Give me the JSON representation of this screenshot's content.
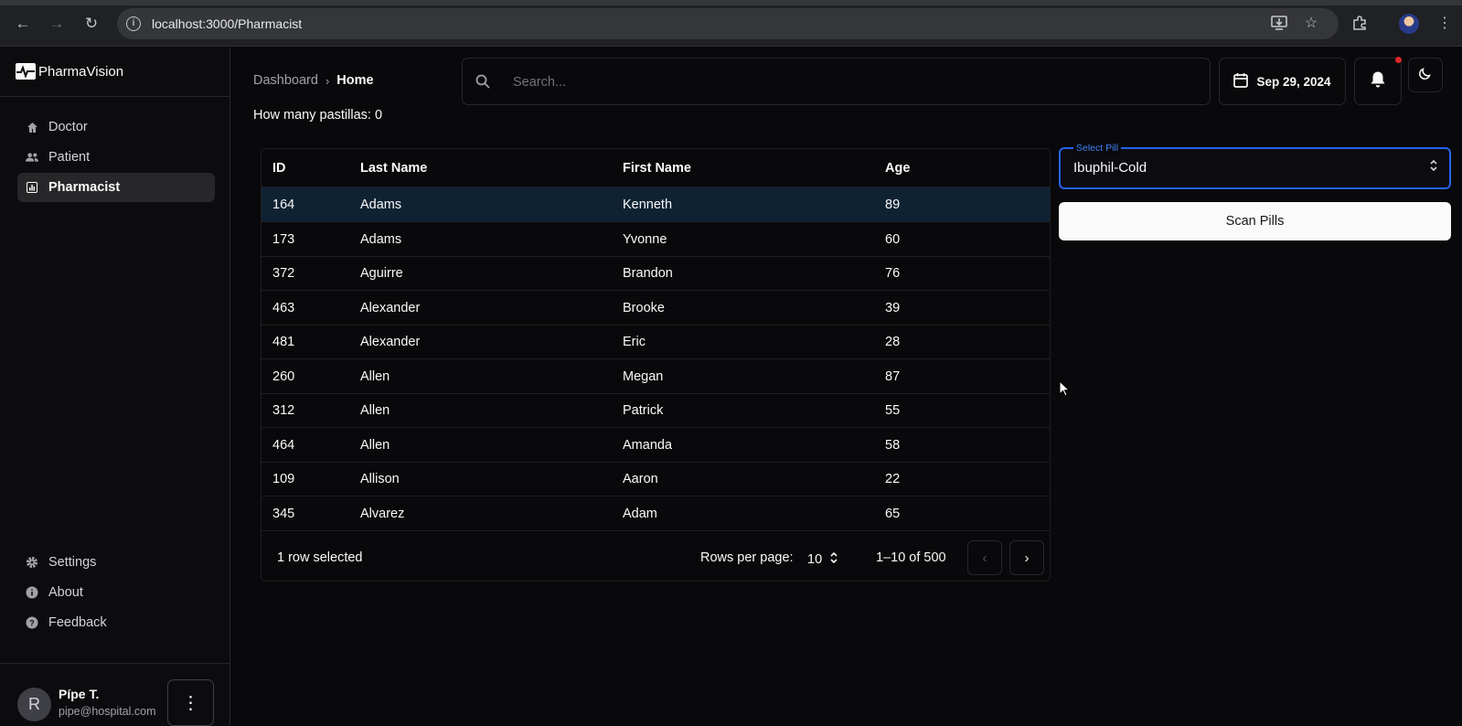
{
  "browser": {
    "url_host": "localhost:3000/Pharmacist",
    "url_path": ""
  },
  "sidebar": {
    "brand": "PharmaVision",
    "items": [
      {
        "label": "Doctor",
        "icon": "home-icon"
      },
      {
        "label": "Patient",
        "icon": "users-icon"
      },
      {
        "label": "Pharmacist",
        "icon": "chart-icon",
        "active": true
      }
    ],
    "bottom_items": [
      {
        "label": "Settings",
        "icon": "gear-icon"
      },
      {
        "label": "About",
        "icon": "info-icon"
      },
      {
        "label": "Feedback",
        "icon": "help-icon"
      }
    ],
    "user": {
      "initial": "R",
      "name": "Pípe T.",
      "email": "pipe@hospital.com"
    }
  },
  "header": {
    "breadcrumb": [
      "Dashboard",
      "Home"
    ],
    "search_placeholder": "Search...",
    "date": "Sep 29, 2024"
  },
  "main": {
    "count_line": "How many pastillas: 0",
    "table": {
      "columns": [
        "ID",
        "Last Name",
        "First Name",
        "Age"
      ],
      "rows": [
        [
          "164",
          "Adams",
          "Kenneth",
          "89"
        ],
        [
          "173",
          "Adams",
          "Yvonne",
          "60"
        ],
        [
          "372",
          "Aguirre",
          "Brandon",
          "76"
        ],
        [
          "463",
          "Alexander",
          "Brooke",
          "39"
        ],
        [
          "481",
          "Alexander",
          "Eric",
          "28"
        ],
        [
          "260",
          "Allen",
          "Megan",
          "87"
        ],
        [
          "312",
          "Allen",
          "Patrick",
          "55"
        ],
        [
          "464",
          "Allen",
          "Amanda",
          "58"
        ],
        [
          "109",
          "Allison",
          "Aaron",
          "22"
        ],
        [
          "345",
          "Alvarez",
          "Adam",
          "65"
        ]
      ],
      "selected_row": 0,
      "footer": {
        "selected_text": "1 row selected",
        "rows_per_page_label": "Rows per page:",
        "rows_per_page": "10",
        "range": "1–10 of 500"
      }
    },
    "pill_select": {
      "label": "Select Pill",
      "value": "Ibuphil-Cold"
    },
    "scan_button": "Scan Pills"
  },
  "colors": {
    "background": "#09090b",
    "selected_row": "#0f2233",
    "focus_border": "#2563eb",
    "notification": "#dc2626"
  }
}
